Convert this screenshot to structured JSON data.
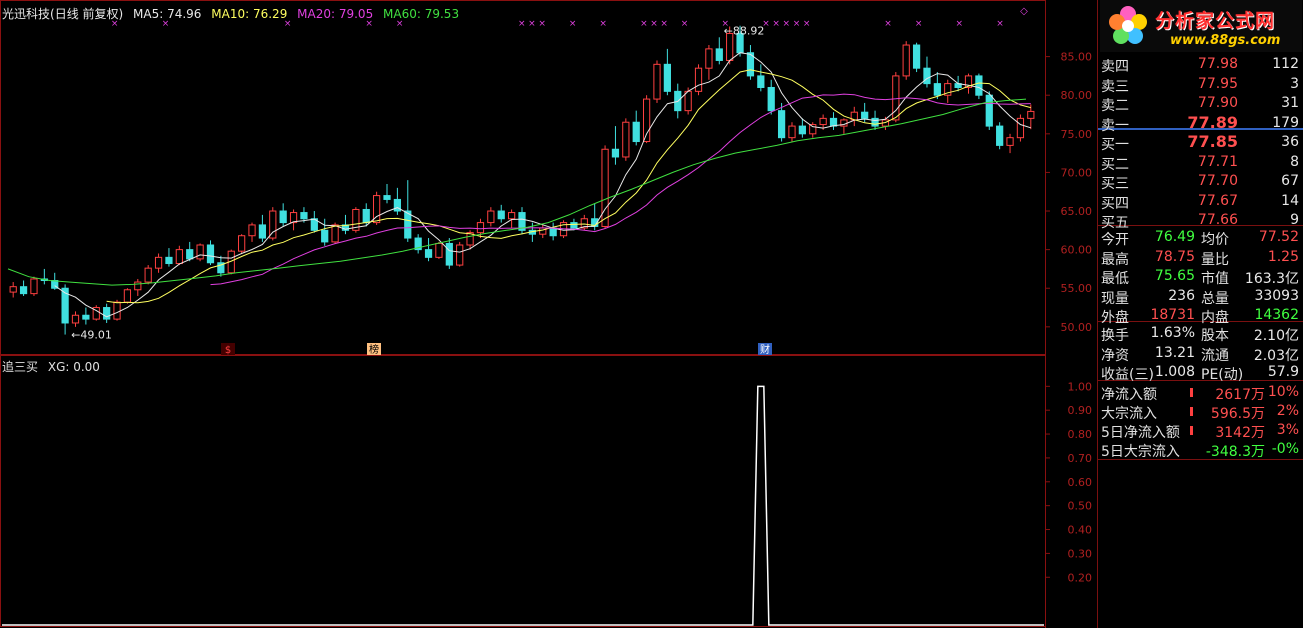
{
  "stock": {
    "name": "光迅科技",
    "period": "(日线 前复权)"
  },
  "ma_legend": [
    {
      "label": "MA5: 74.96",
      "color": "#e8e8e8"
    },
    {
      "label": "MA10: 76.29",
      "color": "#ffff60"
    },
    {
      "label": "MA20: 79.05",
      "color": "#e040e0"
    },
    {
      "label": "MA60: 79.53",
      "color": "#40e040"
    }
  ],
  "sub_legend": {
    "name": "追三买",
    "value": "XG: 0.00"
  },
  "annotations": {
    "high": "88.92",
    "low": "49.01"
  },
  "event_marks": [
    "$",
    "榜",
    "财"
  ],
  "price_axis": [
    "85.00",
    "80.00",
    "75.00",
    "70.00",
    "65.00",
    "60.00",
    "55.00",
    "50.00"
  ],
  "sub_axis": [
    "1.00",
    "0.90",
    "0.80",
    "0.70",
    "0.60",
    "0.50",
    "0.40",
    "0.30",
    "0.20"
  ],
  "logo": {
    "brand": "分析家公式网",
    "url": "www.88gs.com"
  },
  "order_book": {
    "asks": [
      {
        "label": "卖四",
        "price": "77.98",
        "vol": "112"
      },
      {
        "label": "卖三",
        "price": "77.95",
        "vol": "3"
      },
      {
        "label": "卖二",
        "price": "77.90",
        "vol": "31"
      },
      {
        "label": "卖一",
        "price": "77.89",
        "vol": "179"
      }
    ],
    "bids": [
      {
        "label": "买一",
        "price": "77.85",
        "vol": "36"
      },
      {
        "label": "买二",
        "price": "77.71",
        "vol": "8"
      },
      {
        "label": "买三",
        "price": "77.70",
        "vol": "67"
      },
      {
        "label": "买四",
        "price": "77.67",
        "vol": "14"
      },
      {
        "label": "买五",
        "price": "77.66",
        "vol": "9"
      }
    ]
  },
  "quote": [
    {
      "l1": "今开",
      "v1": "76.49",
      "c1": "green",
      "l2": "均价",
      "v2": "77.52",
      "c2": "red"
    },
    {
      "l1": "最高",
      "v1": "78.75",
      "c1": "red",
      "l2": "量比",
      "v2": "1.25",
      "c2": "red"
    },
    {
      "l1": "最低",
      "v1": "75.65",
      "c1": "green",
      "l2": "市值",
      "v2": "163.3亿",
      "c2": "white"
    },
    {
      "l1": "现量",
      "v1": "236",
      "c1": "white",
      "l2": "总量",
      "v2": "33093",
      "c2": "white"
    },
    {
      "l1": "外盘",
      "v1": "18731",
      "c1": "red",
      "l2": "内盘",
      "v2": "14362",
      "c2": "green"
    }
  ],
  "fundamentals": [
    {
      "l1": "换手",
      "v1": "1.63%",
      "l2": "股本",
      "v2": "2.10亿"
    },
    {
      "l1": "净资",
      "v1": "13.21",
      "l2": "流通",
      "v2": "2.03亿"
    },
    {
      "l1": "收益(三)",
      "v1": "1.008",
      "l2": "PE(动)",
      "v2": "57.9"
    }
  ],
  "flows": [
    {
      "label": "净流入额",
      "value": "2617万",
      "pct": "10%",
      "color": "red"
    },
    {
      "label": "大宗流入",
      "value": "596.5万",
      "pct": "2%",
      "color": "red"
    },
    {
      "label": "5日净流入额",
      "value": "3142万",
      "pct": "3%",
      "color": "red"
    },
    {
      "label": "5日大宗流入",
      "value": "-348.3万",
      "pct": "-0%",
      "color": "green"
    }
  ],
  "chart_data": {
    "type": "candlestick",
    "ylim": [
      47,
      90
    ],
    "candles": [
      [
        54.5,
        55.8,
        53.8,
        55.2
      ],
      [
        55.2,
        56.0,
        54.0,
        54.3
      ],
      [
        54.3,
        56.5,
        54.0,
        56.2
      ],
      [
        56.2,
        57.5,
        55.5,
        56.0
      ],
      [
        56.0,
        57.0,
        54.8,
        55.0
      ],
      [
        55.0,
        55.5,
        49.0,
        50.5
      ],
      [
        50.5,
        52.0,
        50.0,
        51.5
      ],
      [
        51.5,
        52.5,
        50.3,
        51.0
      ],
      [
        51.0,
        52.8,
        50.8,
        52.5
      ],
      [
        52.5,
        53.0,
        50.5,
        51.0
      ],
      [
        51.0,
        53.5,
        50.8,
        53.2
      ],
      [
        53.2,
        55.0,
        53.0,
        54.8
      ],
      [
        54.8,
        56.2,
        54.0,
        55.8
      ],
      [
        55.8,
        58.0,
        55.5,
        57.6
      ],
      [
        57.6,
        59.5,
        57.0,
        59.0
      ],
      [
        59.0,
        60.2,
        57.8,
        58.2
      ],
      [
        58.2,
        60.5,
        58.0,
        60.0
      ],
      [
        60.0,
        61.0,
        58.5,
        58.8
      ],
      [
        58.8,
        60.8,
        58.5,
        60.6
      ],
      [
        60.6,
        61.2,
        58.0,
        58.3
      ],
      [
        58.3,
        59.2,
        56.5,
        57.0
      ],
      [
        57.0,
        60.0,
        56.8,
        59.8
      ],
      [
        59.8,
        62.0,
        59.5,
        61.8
      ],
      [
        61.8,
        63.5,
        61.0,
        63.2
      ],
      [
        63.2,
        64.5,
        61.0,
        61.5
      ],
      [
        61.5,
        65.5,
        61.2,
        65.0
      ],
      [
        65.0,
        66.0,
        63.0,
        63.5
      ],
      [
        63.5,
        65.2,
        62.5,
        64.8
      ],
      [
        64.8,
        65.5,
        63.5,
        64.0
      ],
      [
        64.0,
        65.0,
        62.2,
        62.5
      ],
      [
        62.5,
        64.0,
        60.5,
        61.0
      ],
      [
        61.0,
        63.5,
        60.8,
        63.2
      ],
      [
        63.2,
        64.5,
        62.0,
        62.5
      ],
      [
        62.5,
        65.5,
        62.2,
        65.2
      ],
      [
        65.2,
        66.0,
        63.0,
        63.5
      ],
      [
        63.5,
        67.5,
        63.2,
        67.0
      ],
      [
        67.0,
        68.5,
        66.0,
        66.5
      ],
      [
        66.5,
        68.0,
        64.5,
        65.0
      ],
      [
        65.0,
        69.0,
        61.0,
        61.5
      ],
      [
        61.5,
        62.0,
        59.5,
        60.0
      ],
      [
        60.0,
        61.5,
        58.5,
        59.0
      ],
      [
        59.0,
        61.0,
        58.8,
        60.8
      ],
      [
        60.8,
        61.5,
        57.5,
        58.0
      ],
      [
        58.0,
        61.0,
        57.8,
        60.6
      ],
      [
        60.6,
        62.5,
        60.0,
        62.2
      ],
      [
        62.2,
        64.0,
        61.5,
        63.5
      ],
      [
        63.5,
        65.5,
        63.0,
        65.0
      ],
      [
        65.0,
        65.8,
        63.5,
        64.0
      ],
      [
        64.0,
        65.2,
        62.8,
        64.8
      ],
      [
        64.8,
        65.5,
        62.0,
        62.5
      ],
      [
        62.5,
        63.5,
        61.0,
        62.0
      ],
      [
        62.0,
        63.2,
        61.5,
        62.8
      ],
      [
        62.8,
        63.5,
        61.2,
        61.8
      ],
      [
        61.8,
        63.8,
        61.5,
        63.5
      ],
      [
        63.5,
        64.0,
        62.5,
        62.8
      ],
      [
        62.8,
        64.5,
        62.5,
        64.0
      ],
      [
        64.0,
        66.0,
        62.5,
        63.0
      ],
      [
        63.0,
        73.5,
        62.8,
        73.0
      ],
      [
        73.0,
        76.0,
        71.0,
        72.0
      ],
      [
        72.0,
        77.0,
        71.5,
        76.5
      ],
      [
        76.5,
        78.0,
        73.5,
        74.0
      ],
      [
        74.0,
        80.0,
        73.8,
        79.5
      ],
      [
        79.5,
        84.5,
        79.0,
        84.0
      ],
      [
        84.0,
        86.0,
        80.0,
        80.5
      ],
      [
        80.5,
        81.5,
        77.0,
        78.0
      ],
      [
        78.0,
        81.0,
        77.5,
        80.5
      ],
      [
        80.5,
        84.0,
        80.0,
        83.5
      ],
      [
        83.5,
        86.5,
        82.0,
        86.0
      ],
      [
        86.0,
        87.5,
        84.0,
        84.5
      ],
      [
        84.5,
        88.9,
        84.0,
        88.0
      ],
      [
        88.0,
        89.0,
        85.0,
        85.5
      ],
      [
        85.5,
        86.5,
        82.0,
        82.5
      ],
      [
        82.5,
        84.0,
        80.5,
        81.0
      ],
      [
        81.0,
        82.0,
        77.5,
        78.0
      ],
      [
        78.0,
        79.0,
        74.0,
        74.5
      ],
      [
        74.5,
        76.5,
        74.0,
        76.0
      ],
      [
        76.0,
        77.0,
        74.5,
        75.0
      ],
      [
        75.0,
        76.5,
        74.5,
        76.2
      ],
      [
        76.2,
        77.5,
        75.5,
        77.0
      ],
      [
        77.0,
        77.8,
        75.5,
        76.0
      ],
      [
        76.0,
        77.0,
        75.0,
        76.8
      ],
      [
        76.8,
        78.5,
        76.0,
        77.8
      ],
      [
        77.8,
        79.0,
        76.5,
        77.0
      ],
      [
        77.0,
        78.0,
        75.5,
        76.0
      ],
      [
        76.0,
        77.2,
        75.5,
        76.8
      ],
      [
        76.8,
        83.0,
        76.5,
        82.5
      ],
      [
        82.5,
        87.0,
        82.0,
        86.5
      ],
      [
        86.5,
        86.8,
        83.0,
        83.5
      ],
      [
        83.5,
        85.0,
        81.0,
        81.5
      ],
      [
        81.5,
        83.0,
        79.5,
        80.0
      ],
      [
        80.0,
        82.0,
        79.0,
        81.5
      ],
      [
        81.5,
        82.5,
        80.5,
        81.0
      ],
      [
        81.0,
        82.8,
        80.2,
        82.5
      ],
      [
        82.5,
        82.8,
        79.5,
        80.0
      ],
      [
        80.0,
        80.5,
        75.5,
        76.0
      ],
      [
        76.0,
        76.5,
        73.0,
        73.5
      ],
      [
        73.5,
        75.0,
        72.5,
        74.5
      ],
      [
        74.5,
        77.5,
        74.0,
        77.0
      ],
      [
        77.0,
        78.8,
        75.6,
        77.9
      ]
    ],
    "ma60": [
      57.5,
      56.5,
      56.0,
      55.8,
      55.6,
      55.4,
      55.5,
      55.7,
      56.0,
      56.3,
      56.6,
      57.0,
      57.3,
      57.6,
      57.9,
      58.2,
      58.5,
      58.9,
      59.3,
      59.8,
      60.4,
      61.0,
      61.6,
      62.1,
      62.5,
      62.9,
      63.5,
      64.5,
      65.7,
      66.8,
      67.8,
      68.9,
      70.0,
      71.0,
      71.8,
      72.5,
      73.0,
      73.5,
      74.1,
      74.5,
      74.8,
      75.3,
      75.8,
      76.3,
      76.9,
      77.5,
      78.3,
      79.0,
      79.3,
      79.5
    ],
    "sub_series": {
      "name": "XG",
      "ylim": [
        0,
        1.06
      ],
      "spike_index": 72,
      "spike_value": 1.0
    }
  }
}
